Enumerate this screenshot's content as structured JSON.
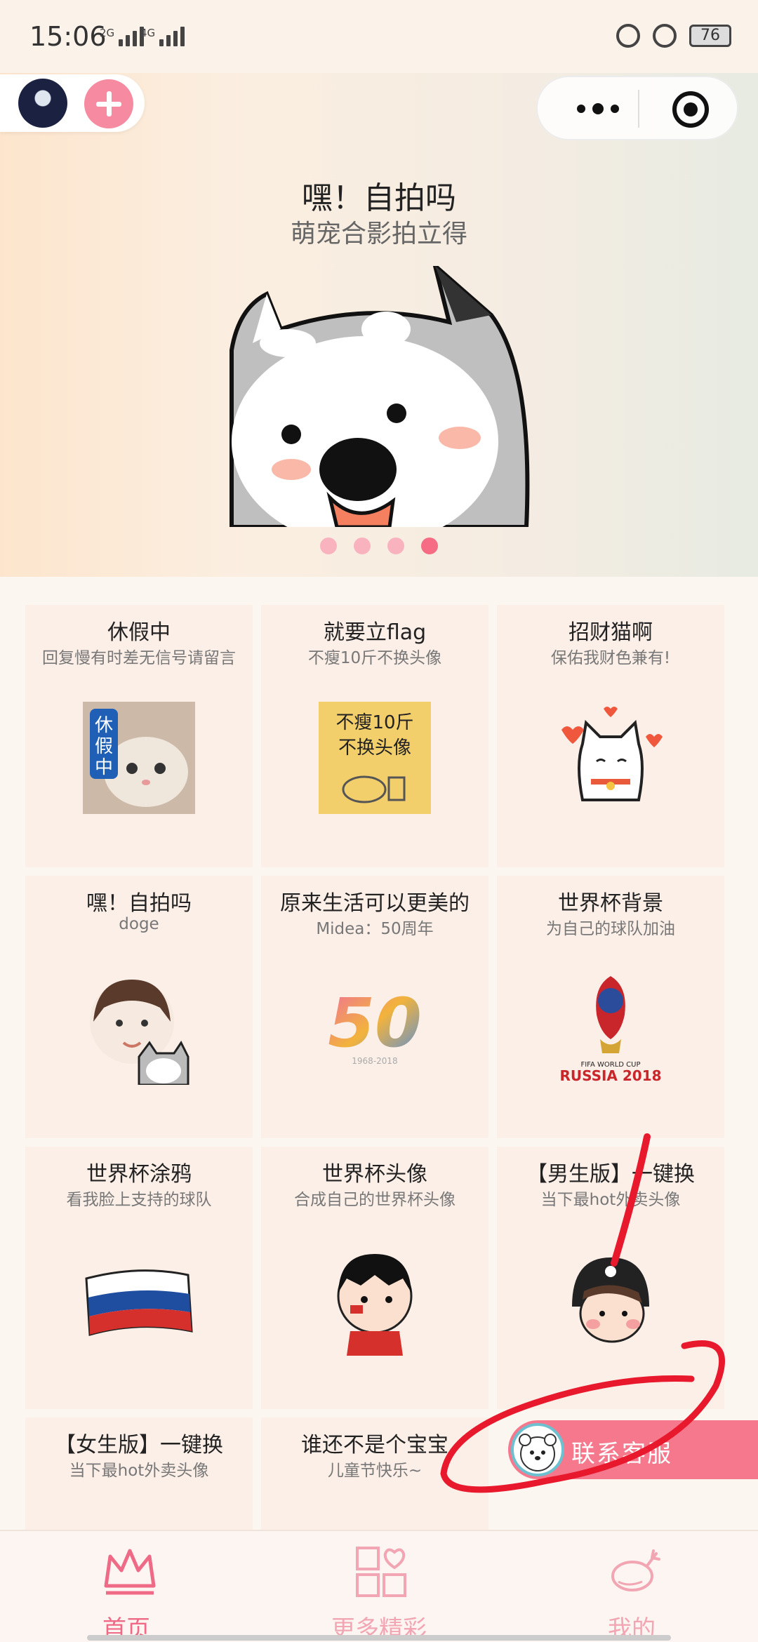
{
  "status_bar": {
    "time": "15:06",
    "signal_1": "2G",
    "signal_2": "4G",
    "battery": "76"
  },
  "header": {
    "avatar_icon": "user-avatar",
    "add_icon": "plus-icon",
    "more_icon": "more-dots-icon",
    "close_icon": "target-circle-icon"
  },
  "banner": {
    "title": "嘿！自拍吗",
    "subtitle": "萌宠合影拍立得",
    "slide_count": 4,
    "active_slide": 4
  },
  "grid": [
    {
      "title": "休假中",
      "subtitle": "回复慢有时差无信号请留言",
      "badge_text": "休假中"
    },
    {
      "title": "就要立flag",
      "subtitle": "不瘦10斤不换头像",
      "image_text_1": "不瘦10斤",
      "image_text_2": "不换头像"
    },
    {
      "title": "招财猫啊",
      "subtitle": "保佑我财色兼有!"
    },
    {
      "title": "嘿！自拍吗",
      "subtitle": "doge"
    },
    {
      "title": "原来生活可以更美的",
      "subtitle": "Midea：50周年",
      "image_text_1": "50",
      "image_text_2": "1968-2018"
    },
    {
      "title": "世界杯背景",
      "subtitle": "为自己的球队加油",
      "image_text_1": "FIFA WORLD CUP",
      "image_text_2": "RUSSIA 2018"
    },
    {
      "title": "世界杯涂鸦",
      "subtitle": "看我脸上支持的球队"
    },
    {
      "title": "世界杯头像",
      "subtitle": "合成自己的世界杯头像"
    },
    {
      "title": "【男生版】一键换",
      "subtitle": "当下最hot外卖头像"
    },
    {
      "title": "【女生版】一键换",
      "subtitle": "当下最hot外卖头像"
    },
    {
      "title": "谁还不是个宝宝",
      "subtitle": "儿童节快乐~"
    }
  ],
  "contact": {
    "label": "联系客服"
  },
  "tabbar": [
    {
      "label": "首页",
      "icon": "crown-icon",
      "active": true
    },
    {
      "label": "更多精彩",
      "icon": "grid-heart-icon",
      "active": false
    },
    {
      "label": "我的",
      "icon": "chicken-leg-icon",
      "active": false
    }
  ],
  "colors": {
    "accent_pink": "#f56c84",
    "annotation_red": "#e8192c",
    "card_bg": "#fcefe8"
  }
}
